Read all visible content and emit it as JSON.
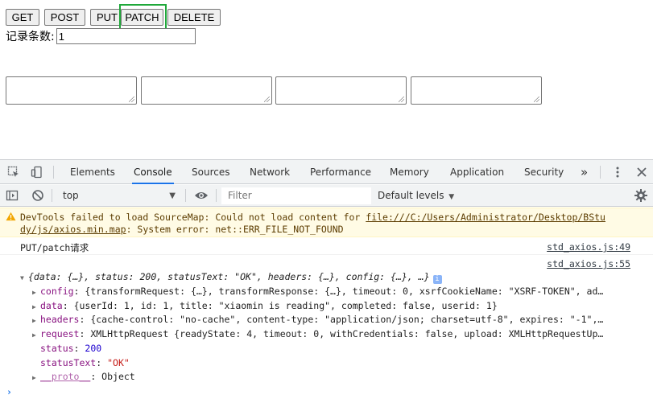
{
  "page": {
    "buttons": [
      "GET",
      "POST",
      "PUT",
      "PATCH",
      "DELETE"
    ],
    "count_label": "记录条数:",
    "count_value": "1"
  },
  "devtools": {
    "tabs": [
      "Elements",
      "Console",
      "Sources",
      "Network",
      "Performance",
      "Memory",
      "Application",
      "Security"
    ],
    "active_tab": "Console",
    "more_tabs": "»",
    "context": "top",
    "filter_placeholder": "Filter",
    "levels": "Default levels"
  },
  "console": {
    "warning": {
      "line1_prefix": "DevTools failed to load SourceMap: Could not load content for ",
      "line1_link": "file:///C:/Users/Administrator/Desktop/BStu",
      "line2_link": "dy/js/axios.min.map",
      "line2_suffix": ": System error: net::ERR_FILE_NOT_FOUND"
    },
    "log1": {
      "text": "PUT/patch请求",
      "source": "std_axios.js:49"
    },
    "log2": {
      "source": "std_axios.js:55",
      "summary": "{data: {…}, status: 200, statusText: \"OK\", headers: {…}, config: {…}, …}",
      "config": {
        "key": "config",
        "value": "{transformRequest: {…}, transformResponse: {…}, timeout: 0, xsrfCookieName: \"XSRF-TOKEN\", ad…"
      },
      "data": {
        "key": "data",
        "value": "{userId: 1, id: 1, title: \"xiaomin is reading\", completed: false, userid: 1}"
      },
      "headers": {
        "key": "headers",
        "value": "{cache-control: \"no-cache\", content-type: \"application/json; charset=utf-8\", expires: \"-1\",…"
      },
      "request": {
        "key": "request",
        "value": "XMLHttpRequest {readyState: 4, timeout: 0, withCredentials: false, upload: XMLHttpRequestUp…"
      },
      "status": {
        "key": "status",
        "value": "200"
      },
      "statusText": {
        "key": "statusText",
        "value": "\"OK\""
      },
      "proto": {
        "key": "__proto__",
        "value": "Object"
      }
    },
    "prompt": "›"
  },
  "colors": {
    "accent": "#1a73e8",
    "highlight_box": "#1fa83a",
    "warning_bg": "#fffbe5"
  }
}
